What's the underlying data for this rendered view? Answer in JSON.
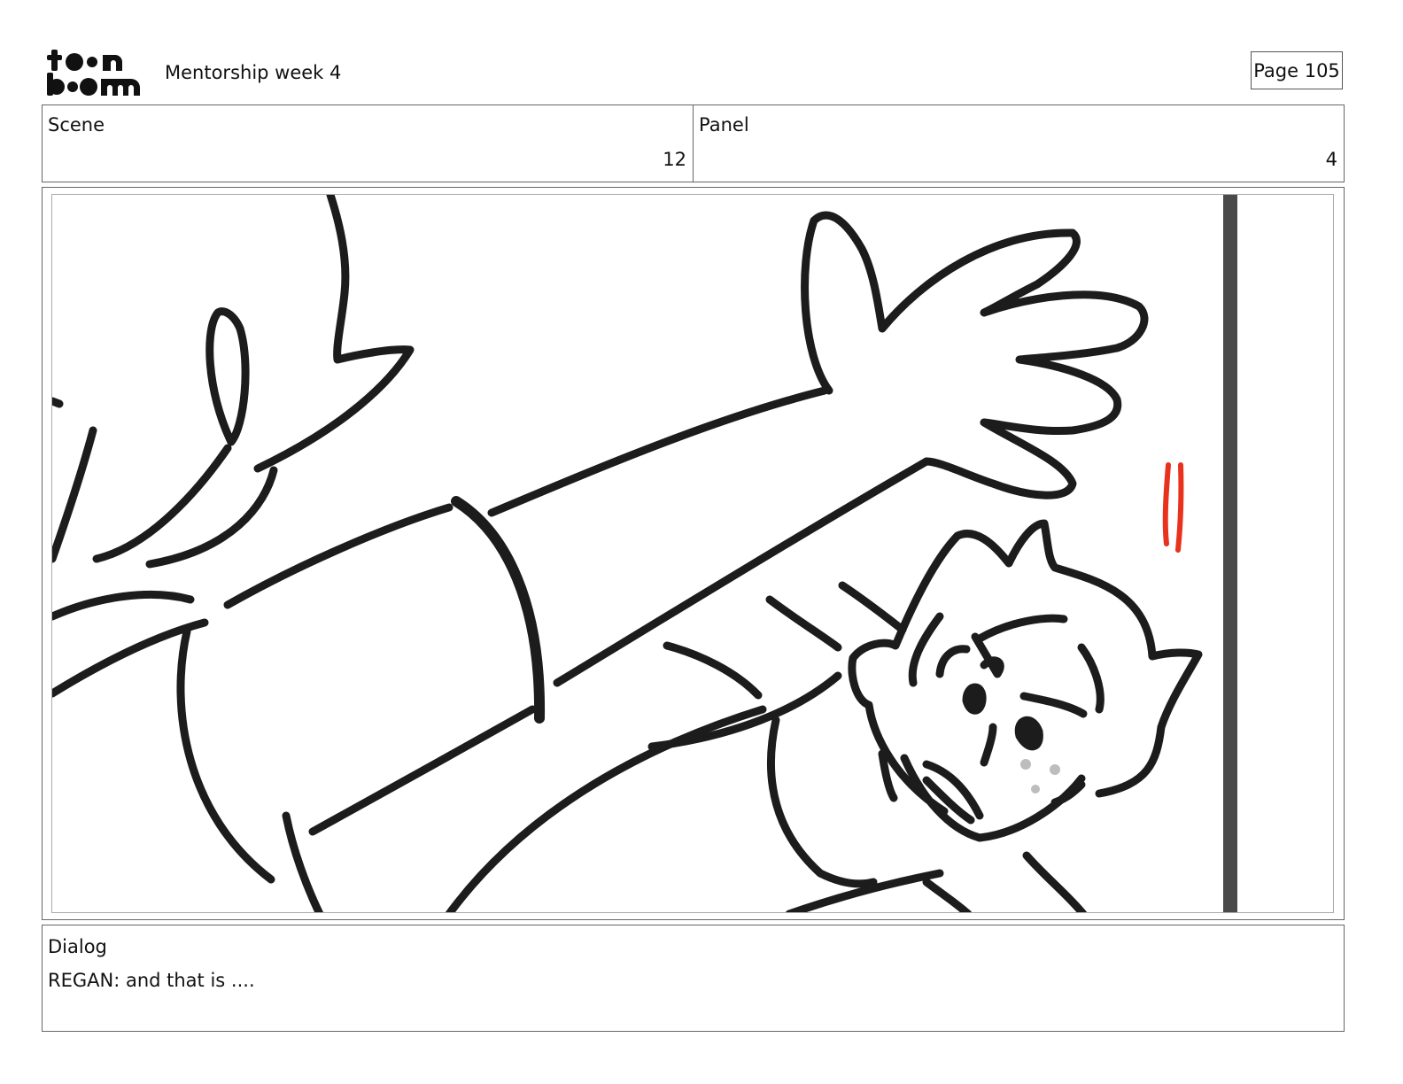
{
  "header": {
    "logo_text_top": "toon",
    "logo_text_bottom": "boom",
    "project_title": "Mentorship week 4",
    "page_label": "Page 105"
  },
  "info": {
    "scene_label": "Scene",
    "scene_value": "12",
    "panel_label": "Panel",
    "panel_value": "4"
  },
  "panel": {
    "image_description_icon": "storyboard-sketch",
    "ink_color": "#1c1c1c",
    "accent_color": "#e8321e",
    "blush_color": "#bdbdbd",
    "bar_color": "#4a4a4a"
  },
  "dialog": {
    "label": "Dialog",
    "text": "REGAN: and that is ...."
  }
}
